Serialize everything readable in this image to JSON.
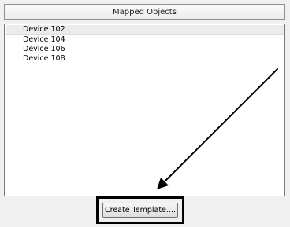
{
  "panel": {
    "header_label": "Mapped Objects"
  },
  "list": {
    "items": [
      {
        "label": "Device 102"
      },
      {
        "label": "Device 104"
      },
      {
        "label": "Device 106"
      },
      {
        "label": "Device 108"
      }
    ]
  },
  "actions": {
    "create_template_label": "Create Template...."
  },
  "annotation": {
    "arrow_color": "#000000",
    "highlight_color": "#000000"
  },
  "colors": {
    "background": "#f0f0f0",
    "list_background": "#ffffff",
    "selected_row": "#ececec"
  }
}
